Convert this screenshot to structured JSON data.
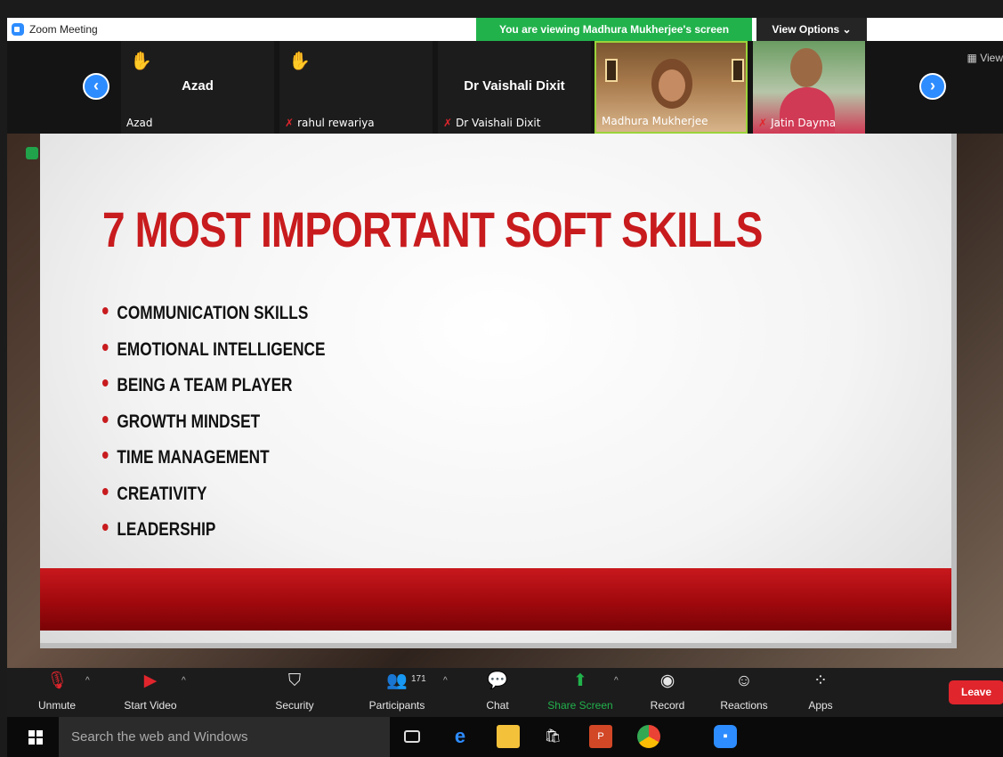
{
  "window": {
    "title": "Zoom Meeting",
    "viewing_banner": "You are viewing Madhura Mukherjee's screen",
    "view_options": "View Options ⌄",
    "view_corner": "View"
  },
  "participants": [
    {
      "display_name": "Azad",
      "label": "Azad",
      "hand_raised": true,
      "muted": false
    },
    {
      "display_name": "",
      "label": "rahul rewariya",
      "hand_raised": true,
      "muted": true
    },
    {
      "display_name": "Dr Vaishali Dixit",
      "label": "Dr Vaishali Dixit",
      "hand_raised": false,
      "muted": true
    },
    {
      "display_name": "",
      "label": "Madhura Mukherjee",
      "hand_raised": false,
      "muted": false,
      "video": true,
      "active_speaker": true
    },
    {
      "display_name": "",
      "label": "Jatin Dayma",
      "hand_raised": false,
      "muted": true,
      "video": true
    }
  ],
  "slide": {
    "title": "7 MOST IMPORTANT SOFT SKILLS",
    "skills": [
      "COMMUNICATION SKILLS",
      "EMOTIONAL INTELLIGENCE",
      "BEING A TEAM PLAYER",
      "GROWTH MINDSET",
      "TIME MANAGEMENT",
      "CREATIVITY",
      "LEADERSHIP"
    ],
    "accent_color": "#c81b1e"
  },
  "toolbar": {
    "unmute": "Unmute",
    "start_video": "Start Video",
    "security": "Security",
    "participants": "Participants",
    "participants_count": "171",
    "chat": "Chat",
    "share_screen": "Share Screen",
    "record": "Record",
    "reactions": "Reactions",
    "apps": "Apps",
    "leave": "Leave"
  },
  "taskbar": {
    "search_placeholder": "Search the web and Windows"
  },
  "colors": {
    "zoom_blue": "#2d8cff",
    "share_green": "#22b24c",
    "leave_red": "#e0252c"
  }
}
